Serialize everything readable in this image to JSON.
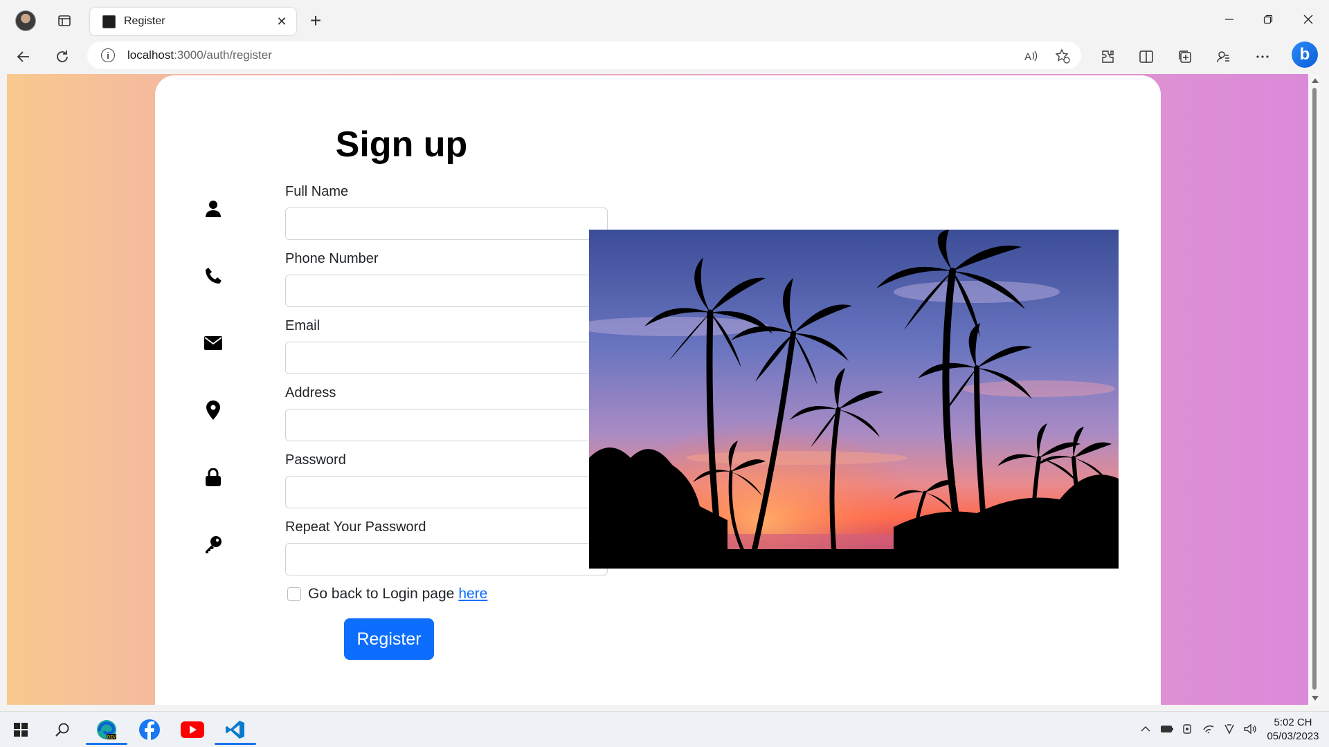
{
  "browser": {
    "tab_title": "Register",
    "url_host": "localhost",
    "url_rest": ":3000/auth/register",
    "new_tab_symbol": "+",
    "close_symbol": "✕"
  },
  "page": {
    "title": "Sign up",
    "fields": [
      {
        "label": "Full Name",
        "icon": "user-icon",
        "value": ""
      },
      {
        "label": "Phone Number",
        "icon": "phone-icon",
        "value": ""
      },
      {
        "label": "Email",
        "icon": "envelope-icon",
        "value": ""
      },
      {
        "label": "Address",
        "icon": "location-pin-icon",
        "value": ""
      },
      {
        "label": "Password",
        "icon": "lock-icon",
        "value": ""
      },
      {
        "label": "Repeat Your Password",
        "icon": "key-icon",
        "value": ""
      }
    ],
    "back_text": "Go back to Login page",
    "back_link": "here",
    "register_label": "Register",
    "image_alt": "Palm trees sunset photo"
  },
  "taskbar": {
    "time": "5:02 CH",
    "date": "05/03/2023",
    "apps": [
      "start-icon",
      "search-icon",
      "edge-dev-icon",
      "facebook-icon",
      "youtube-icon",
      "vscode-icon"
    ]
  },
  "colors": {
    "accent": "#0d6efd",
    "gradient_start": "#f9c98e",
    "gradient_end": "#db8ad9"
  }
}
